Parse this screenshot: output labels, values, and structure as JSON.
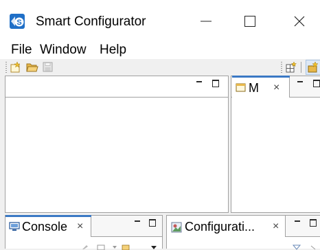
{
  "window": {
    "title": "Smart Configurator"
  },
  "menu": {
    "file": "File",
    "window": "Window",
    "help": "Help"
  },
  "views": {
    "top_right_tab": "M",
    "console_tab": "Console",
    "config_tab": "Configurati...",
    "close_glyph": "×"
  },
  "colors": {
    "accent": "#3a78c4",
    "app_icon_bg": "#1f6fc7",
    "folder": "#e8b84a"
  },
  "icons": {
    "app": "smart-configurator-logo",
    "new": "new-file-icon",
    "open": "open-folder-icon",
    "save": "save-icon",
    "perspective": "open-perspective-icon",
    "active_perspective": "smart-configurator-perspective-icon"
  }
}
